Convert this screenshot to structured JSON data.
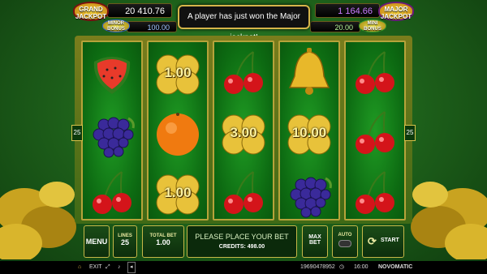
{
  "jackpots": {
    "grand": {
      "label_1": "GRAND",
      "label_2": "JACKPOT",
      "value": "20 410.76"
    },
    "major": {
      "label_1": "MAJOR",
      "label_2": "JACKPOT",
      "value": "1 164.66"
    },
    "minor": {
      "label_1": "MINOR",
      "label_2": "BONUS",
      "value": "100.00"
    },
    "mini": {
      "label_1": "MINI",
      "label_2": "BONUS",
      "value": "20.00"
    }
  },
  "notice_text": "A player has just won the Major jackpot!",
  "line_markers": {
    "left": "25",
    "right": "25"
  },
  "reels": [
    [
      "watermelon",
      "grapes",
      "cherries"
    ],
    [
      "clover",
      "orange",
      "clover"
    ],
    [
      "cherries",
      "clover",
      "cherries"
    ],
    [
      "bell",
      "clover",
      "grapes"
    ],
    [
      "cherries",
      "cherries",
      "cherries"
    ]
  ],
  "clover_values": {
    "r2_top": "1.00",
    "r2_bottom": "1.00",
    "r3_mid": "3.00",
    "r4_mid": "10.00"
  },
  "controls": {
    "menu_label": "MENU",
    "lines_label": "LINES",
    "lines_value": "25",
    "total_bet_label": "TOTAL BET",
    "total_bet_value": "1.00",
    "message": "PLEASE PLACE YOUR BET",
    "credits": "CREDITS: 498.00",
    "max_bet_label_1": "MAX",
    "max_bet_label_2": "BET",
    "auto_label": "AUTO",
    "start_label": "START"
  },
  "system_bar": {
    "exit": "EXIT",
    "session_id": "19690478952",
    "time": "16:00",
    "brand": "NOVOMATIC"
  },
  "colors": {
    "cherry": "#d4141a",
    "grape": "#3a2a9a",
    "orange": "#f07a10",
    "gold": "#e8c23a"
  }
}
